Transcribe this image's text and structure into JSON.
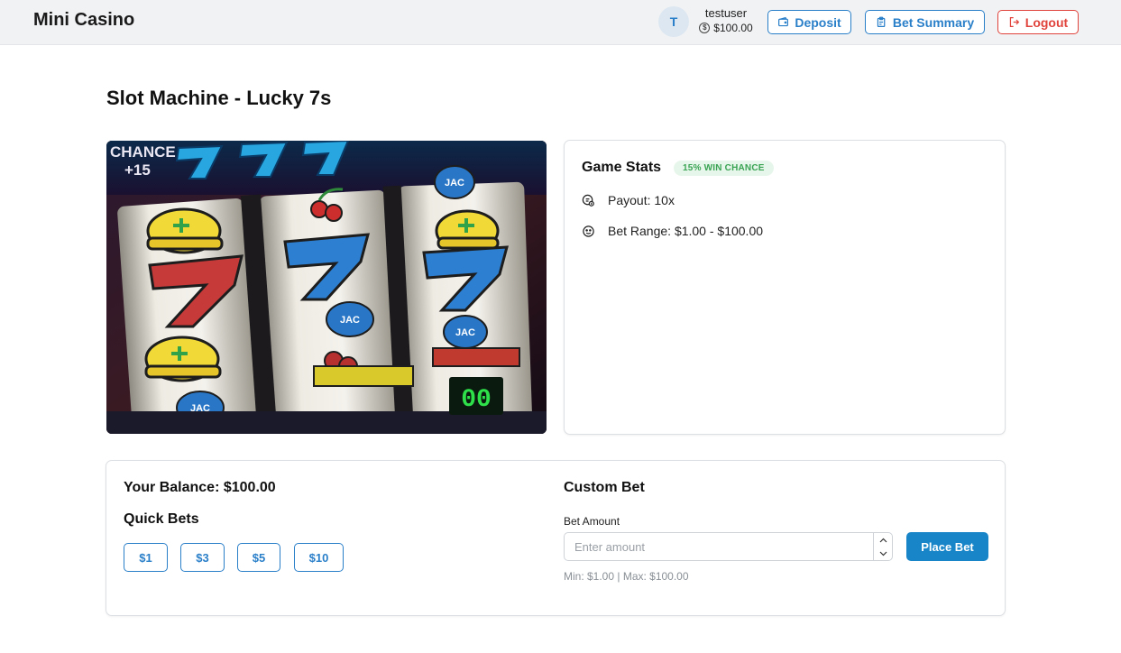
{
  "header": {
    "brand": "Mini Casino",
    "avatar_initial": "T",
    "username": "testuser",
    "balance": "$100.00",
    "deposit_label": "Deposit",
    "bet_summary_label": "Bet Summary",
    "logout_label": "Logout"
  },
  "page": {
    "title": "Slot Machine - Lucky 7s"
  },
  "slot_image": {
    "chance_text": "CHANCE",
    "chance_value": "+15",
    "reel_label": "JAC",
    "counter": "00"
  },
  "game_stats": {
    "title": "Game Stats",
    "badge": "15% WIN CHANCE",
    "payout": "Payout: 10x",
    "bet_range": "Bet Range: $1.00 - $100.00"
  },
  "betting": {
    "balance": "Your Balance: $100.00",
    "quick_bets_title": "Quick Bets",
    "quick_bets": [
      "$1",
      "$3",
      "$5",
      "$10"
    ],
    "custom_bet_title": "Custom Bet",
    "bet_amount_label": "Bet Amount",
    "bet_amount_placeholder": "Enter amount",
    "bet_amount_value": "",
    "place_bet_label": "Place Bet",
    "limits": "Min: $1.00 | Max: $100.00"
  },
  "colors": {
    "accent": "#2a7fc9",
    "primary_button": "#1785c8",
    "danger": "#e0433b",
    "success_badge_bg": "#e7f6ea",
    "success_badge_text": "#3aa454",
    "topbar_bg": "#f1f2f4"
  },
  "icons": {
    "deposit": "wallet-icon",
    "bet_summary": "clipboard-icon",
    "logout": "logout-icon",
    "balance": "coin-icon",
    "payout": "coins-icon",
    "bet_range": "smile-icon",
    "stepper_up": "chevron-up-icon",
    "stepper_down": "chevron-down-icon"
  }
}
